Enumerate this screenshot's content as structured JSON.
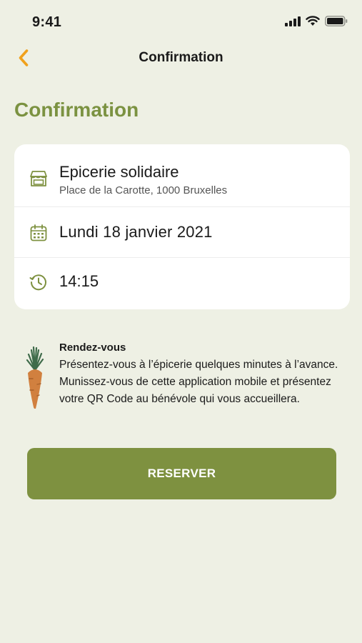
{
  "status_bar": {
    "time": "9:41",
    "icons": [
      "signal-icon",
      "wifi-icon",
      "battery-icon"
    ]
  },
  "nav": {
    "back_icon": "chevron-left-icon",
    "title": "Confirmation"
  },
  "page": {
    "heading": "Confirmation"
  },
  "booking": {
    "store": {
      "icon": "store-icon",
      "name": "Epicerie solidaire",
      "address": "Place de la Carotte, 1000 Bruxelles"
    },
    "date": {
      "icon": "calendar-icon",
      "value": "Lundi 18 janvier 2021"
    },
    "time": {
      "icon": "clock-icon",
      "value": "14:15"
    }
  },
  "info": {
    "icon": "carrot-icon",
    "title": "Rendez-vous",
    "text": "Présentez-vous à l’épicerie quelques minutes à l’avance. Munissez-vous de cette application mobile et présentez votre QR Code au bénévole qui vous accueillera."
  },
  "actions": {
    "reserve_label": "RESERVER"
  },
  "colors": {
    "background": "#eef0e4",
    "accent_green": "#7e9140",
    "heading_green": "#7b9241",
    "back_orange": "#f0a11c",
    "card": "#ffffff"
  }
}
